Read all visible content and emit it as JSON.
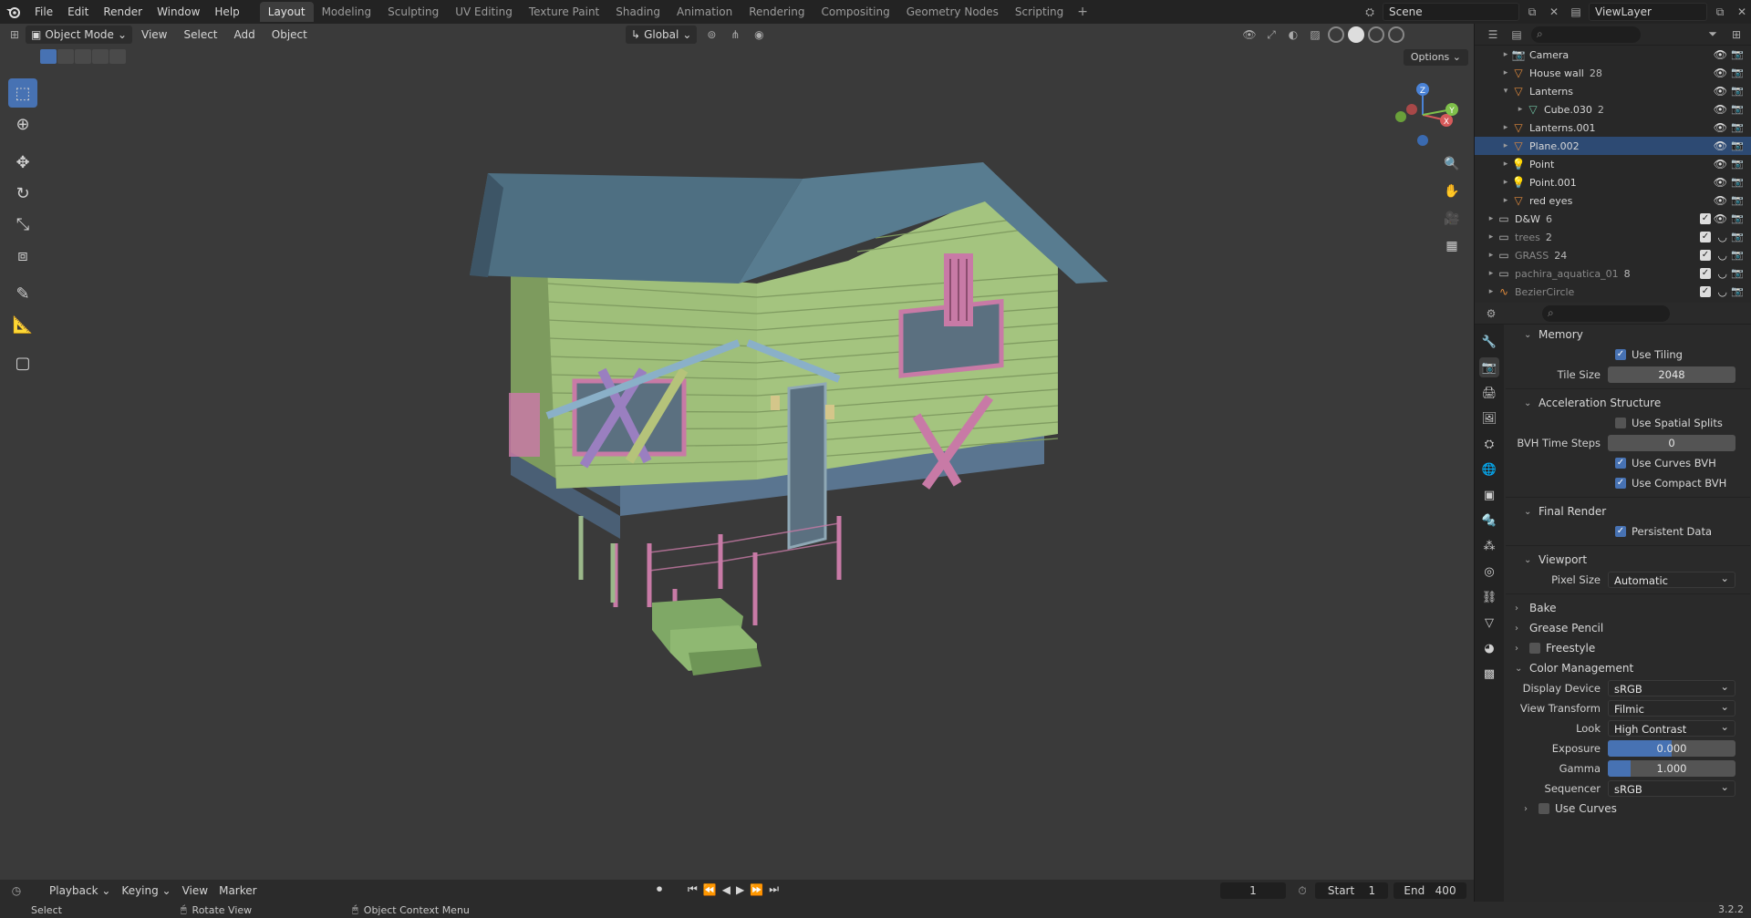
{
  "topbar": {
    "menus": [
      "File",
      "Edit",
      "Render",
      "Window",
      "Help"
    ],
    "workspaces": [
      "Layout",
      "Modeling",
      "Sculpting",
      "UV Editing",
      "Texture Paint",
      "Shading",
      "Animation",
      "Rendering",
      "Compositing",
      "Geometry Nodes",
      "Scripting"
    ],
    "active_workspace": "Layout",
    "plus": "+",
    "scene": "Scene",
    "view_layer": "ViewLayer"
  },
  "viewport": {
    "mode": "Object Mode",
    "menus": [
      "View",
      "Select",
      "Add",
      "Object"
    ],
    "orientation": "Global",
    "options": "Options"
  },
  "gizmo": {
    "x": "X",
    "y": "Y",
    "z": "Z"
  },
  "outliner": {
    "rows": [
      {
        "name": "Camera",
        "icon": "camera-icon",
        "tri": "▸",
        "selected": false,
        "dim": false,
        "level": 2
      },
      {
        "name": "House wall",
        "icon": "mesh-icon",
        "tri": "▸",
        "extra": "28",
        "selected": false,
        "dim": false,
        "level": 2
      },
      {
        "name": "Lanterns",
        "icon": "mesh-icon",
        "tri": "▾",
        "selected": false,
        "dim": false,
        "level": 2
      },
      {
        "name": "Cube.030",
        "icon": "mesh-data-icon",
        "tri": "▸",
        "extra": "2",
        "selected": false,
        "dim": false,
        "level": 3
      },
      {
        "name": "Lanterns.001",
        "icon": "mesh-icon",
        "tri": "▸",
        "selected": false,
        "dim": false,
        "level": 2
      },
      {
        "name": "Plane.002",
        "icon": "mesh-icon",
        "tri": "▸",
        "selected": true,
        "dim": false,
        "level": 2
      },
      {
        "name": "Point",
        "icon": "light-icon",
        "tri": "▸",
        "selected": false,
        "dim": false,
        "level": 2
      },
      {
        "name": "Point.001",
        "icon": "light-icon",
        "tri": "▸",
        "selected": false,
        "dim": false,
        "level": 2
      },
      {
        "name": "red eyes",
        "icon": "mesh-icon",
        "tri": "▸",
        "selected": false,
        "dim": false,
        "level": 2
      },
      {
        "name": "D&W",
        "icon": "collection-icon",
        "tri": "▸",
        "extra": "6",
        "selected": false,
        "dim": false,
        "level": 1
      },
      {
        "name": "trees",
        "icon": "collection-icon",
        "tri": "▸",
        "extra": "2",
        "selected": false,
        "dim": true,
        "level": 1
      },
      {
        "name": "GRASS",
        "icon": "collection-icon",
        "tri": "▸",
        "extra": "24",
        "selected": false,
        "dim": true,
        "level": 1
      },
      {
        "name": "pachira_aquatica_01",
        "icon": "collection-icon",
        "tri": "▸",
        "extra": "8",
        "selected": false,
        "dim": true,
        "level": 1
      },
      {
        "name": "BezierCircle",
        "icon": "curve-icon",
        "tri": "▸",
        "selected": false,
        "dim": true,
        "level": 1
      }
    ]
  },
  "props": {
    "memory": "Memory",
    "use_tiling": "Use Tiling",
    "tile_size_label": "Tile Size",
    "tile_size": "2048",
    "accel": "Acceleration Structure",
    "spatial_splits": "Use Spatial Splits",
    "bvh_label": "BVH Time Steps",
    "bvh": "0",
    "curves_bvh": "Use Curves BVH",
    "compact_bvh": "Use Compact BVH",
    "final_render": "Final Render",
    "persistent": "Persistent Data",
    "viewport": "Viewport",
    "pixel_size_label": "Pixel Size",
    "pixel_size": "Automatic",
    "bake": "Bake",
    "grease": "Grease Pencil",
    "freestyle": "Freestyle",
    "color_mgmt": "Color Management",
    "display_label": "Display Device",
    "display": "sRGB",
    "view_transform_label": "View Transform",
    "view_transform": "Filmic",
    "look_label": "Look",
    "look": "High Contrast",
    "exposure_label": "Exposure",
    "exposure": "0.000",
    "gamma_label": "Gamma",
    "gamma": "1.000",
    "sequencer_label": "Sequencer",
    "sequencer": "sRGB",
    "use_curves": "Use Curves"
  },
  "timeline": {
    "menus": [
      "Playback",
      "Keying",
      "View",
      "Marker"
    ],
    "current_frame": "1",
    "start_label": "Start",
    "start": "1",
    "end_label": "End",
    "end": "400"
  },
  "status": {
    "select": "Select",
    "rotate": "Rotate View",
    "context": "Object Context Menu",
    "version": "3.2.2"
  },
  "colors": {
    "accent": "#4772b3",
    "house_wall": "#9fbf7a",
    "roof": "#4e6f82",
    "trim": "#c87aa6",
    "foundation": "#5a7590"
  }
}
